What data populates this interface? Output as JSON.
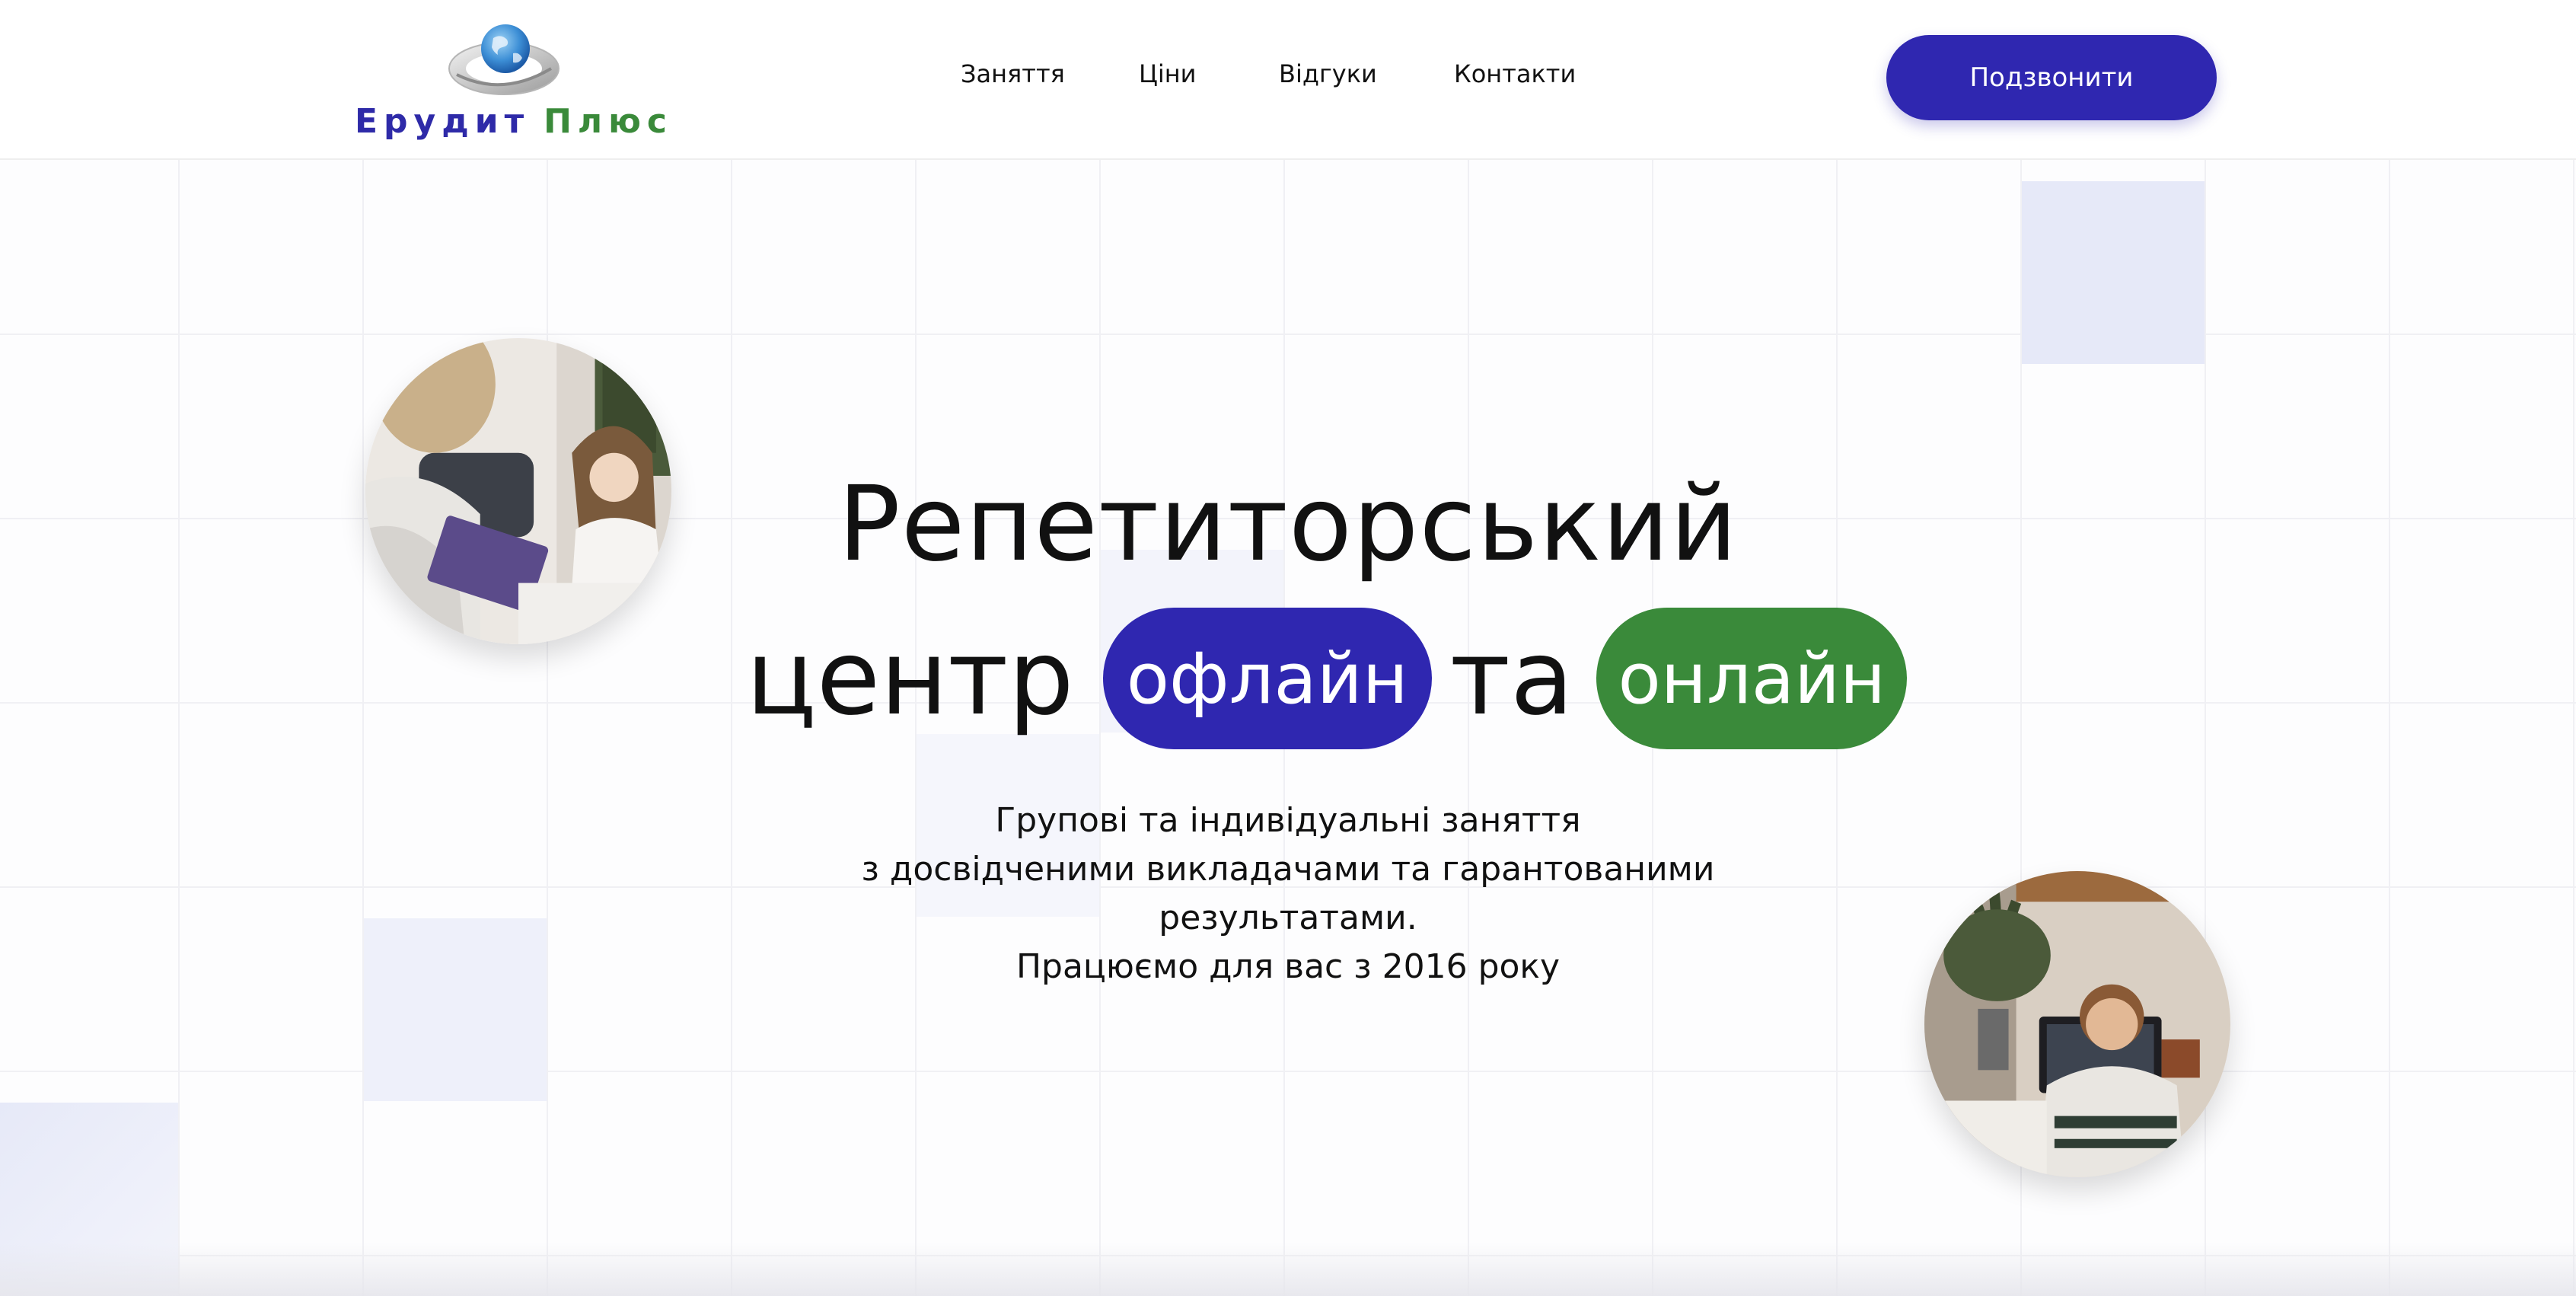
{
  "header": {
    "logo": {
      "word1": "Ерудит",
      "word2": "Плюс"
    },
    "nav": [
      {
        "label": "Заняття"
      },
      {
        "label": "Ціни"
      },
      {
        "label": "Відгуки"
      },
      {
        "label": "Контакти"
      }
    ],
    "call_button": "Подзвонити"
  },
  "hero": {
    "title_line1": "Репетиторський",
    "title_word_center": "центр",
    "pill_offline": "офлайн",
    "title_word_and": "та",
    "pill_online": "онлайн",
    "subtitle": [
      "Групові та індивідуальні заняття",
      "з досвідченими викладачами та гарантованими",
      "результатами.",
      "Працюємо для вас з 2016 року"
    ]
  },
  "colors": {
    "brand_blue": "#2f27b0",
    "brand_green": "#3a8a3a",
    "grid_tile": "#e6e9f8"
  }
}
